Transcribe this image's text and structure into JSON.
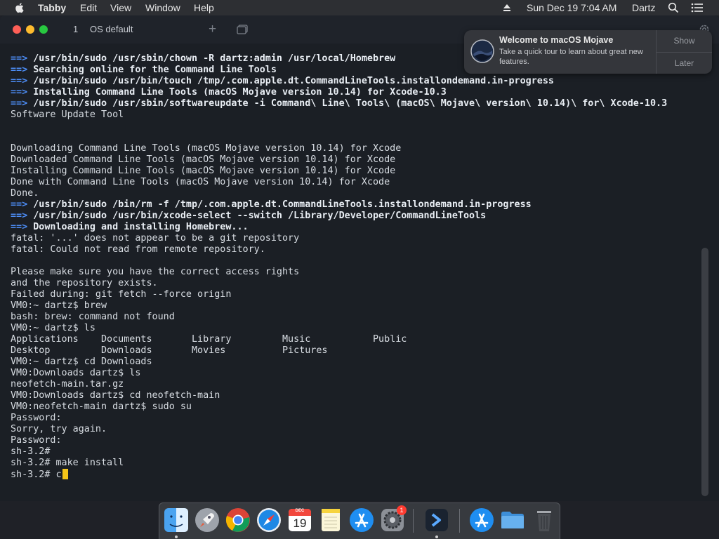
{
  "menubar": {
    "app": "Tabby",
    "items": [
      "Edit",
      "View",
      "Window",
      "Help"
    ],
    "clock": "Sun Dec 19  7:04 AM",
    "user": "Dartz"
  },
  "window": {
    "tab": {
      "number": "1",
      "title": "OS default"
    }
  },
  "notification": {
    "title": "Welcome to macOS Mojave",
    "body": "Take a quick tour to learn about great new features.",
    "show_label": "Show",
    "later_label": "Later"
  },
  "terminal": {
    "lines": [
      {
        "arrow": "==>",
        "text": " /usr/bin/sudo /usr/sbin/chown -R dartz:admin /usr/local/Homebrew"
      },
      {
        "arrow": "==>",
        "text": " Searching online for the Command Line Tools"
      },
      {
        "arrow": "==>",
        "text": " /usr/bin/sudo /usr/bin/touch /tmp/.com.apple.dt.CommandLineTools.installondemand.in-progress"
      },
      {
        "arrow": "==>",
        "text": " Installing Command Line Tools (macOS Mojave version 10.14) for Xcode-10.3"
      },
      {
        "arrow": "==>",
        "text": " /usr/bin/sudo /usr/sbin/softwareupdate -i Command\\ Line\\ Tools\\ (macOS\\ Mojave\\ version\\ 10.14)\\ for\\ Xcode-10.3"
      },
      {
        "text": "Software Update Tool"
      },
      {
        "text": ""
      },
      {
        "text": ""
      },
      {
        "text": "Downloading Command Line Tools (macOS Mojave version 10.14) for Xcode"
      },
      {
        "text": "Downloaded Command Line Tools (macOS Mojave version 10.14) for Xcode"
      },
      {
        "text": "Installing Command Line Tools (macOS Mojave version 10.14) for Xcode"
      },
      {
        "text": "Done with Command Line Tools (macOS Mojave version 10.14) for Xcode"
      },
      {
        "text": "Done."
      },
      {
        "arrow": "==>",
        "text": " /usr/bin/sudo /bin/rm -f /tmp/.com.apple.dt.CommandLineTools.installondemand.in-progress"
      },
      {
        "arrow": "==>",
        "text": " /usr/bin/sudo /usr/bin/xcode-select --switch /Library/Developer/CommandLineTools"
      },
      {
        "arrow": "==>",
        "text": " Downloading and installing Homebrew..."
      },
      {
        "text": "fatal: '...' does not appear to be a git repository"
      },
      {
        "text": "fatal: Could not read from remote repository."
      },
      {
        "text": ""
      },
      {
        "text": "Please make sure you have the correct access rights"
      },
      {
        "text": "and the repository exists."
      },
      {
        "text": "Failed during: git fetch --force origin"
      },
      {
        "text": "VM0:~ dartz$ brew"
      },
      {
        "text": "bash: brew: command not found"
      },
      {
        "text": "VM0:~ dartz$ ls"
      },
      {
        "text": "Applications    Documents       Library         Music           Public"
      },
      {
        "text": "Desktop         Downloads       Movies          Pictures"
      },
      {
        "text": "VM0:~ dartz$ cd Downloads"
      },
      {
        "text": "VM0:Downloads dartz$ ls"
      },
      {
        "text": "neofetch-main.tar.gz"
      },
      {
        "text": "VM0:Downloads dartz$ cd neofetch-main"
      },
      {
        "text": "VM0:neofetch-main dartz$ sudo su"
      },
      {
        "text": "Password:"
      },
      {
        "text": "Sorry, try again."
      },
      {
        "text": "Password:"
      },
      {
        "text": "sh-3.2#"
      },
      {
        "text": "sh-3.2# make install"
      },
      {
        "text": "sh-3.2# c",
        "cursor": true
      }
    ]
  },
  "dock": {
    "calendar_month": "DEC",
    "calendar_day": "19",
    "settings_badge": "1"
  },
  "colors": {
    "arrow": "#4c8df6",
    "cursor": "#f5c518",
    "close": "#fe5f57",
    "minimize": "#febc2e",
    "zoom": "#28c840"
  }
}
